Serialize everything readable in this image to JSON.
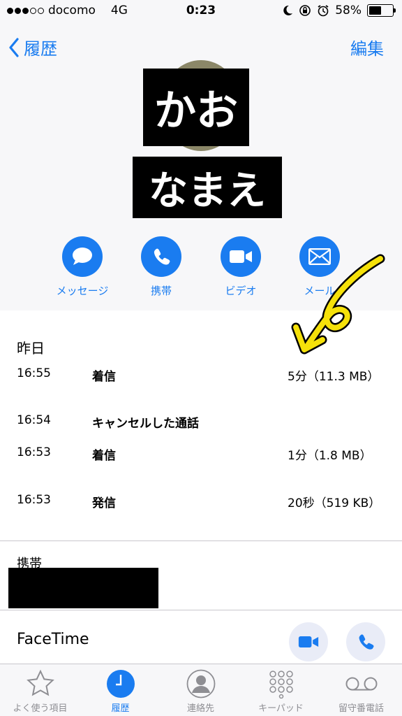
{
  "status": {
    "carrier": "docomo",
    "network": "4G",
    "time": "0:23",
    "battery": "58%",
    "battery_level": 0.58
  },
  "nav": {
    "back_label": "履歴",
    "edit_label": "編集"
  },
  "contact": {
    "redacted_line1": "かお",
    "redacted_line2": "なまえ"
  },
  "actions": [
    {
      "label": "メッセージ",
      "icon": "message-bubble-icon"
    },
    {
      "label": "携帯",
      "icon": "phone-icon"
    },
    {
      "label": "ビデオ",
      "icon": "video-camera-icon"
    },
    {
      "label": "メール",
      "icon": "mail-envelope-icon"
    }
  ],
  "history": {
    "date_label": "昨日",
    "rows": [
      {
        "time": "16:55",
        "type": "着信",
        "detail": "5分（11.3 MB）"
      },
      {
        "time": "16:54",
        "type": "キャンセルした通話",
        "detail": ""
      },
      {
        "time": "16:53",
        "type": "着信",
        "detail": "1分（1.8 MB）"
      },
      {
        "time": "16:53",
        "type": "発信",
        "detail": "20秒（519 KB）"
      }
    ]
  },
  "phone": {
    "label": "携帯"
  },
  "facetime": {
    "label": "FaceTime"
  },
  "tabbar": [
    {
      "label": "よく使う項目",
      "icon": "star-icon",
      "active": false
    },
    {
      "label": "履歴",
      "icon": "clock-icon",
      "active": true
    },
    {
      "label": "連絡先",
      "icon": "person-icon",
      "active": false
    },
    {
      "label": "キーパッド",
      "icon": "keypad-icon",
      "active": false
    },
    {
      "label": "留守番電話",
      "icon": "voicemail-icon",
      "active": false
    }
  ],
  "colors": {
    "accent": "#1a7cf0",
    "annotation_arrow": "#f5e10a"
  }
}
